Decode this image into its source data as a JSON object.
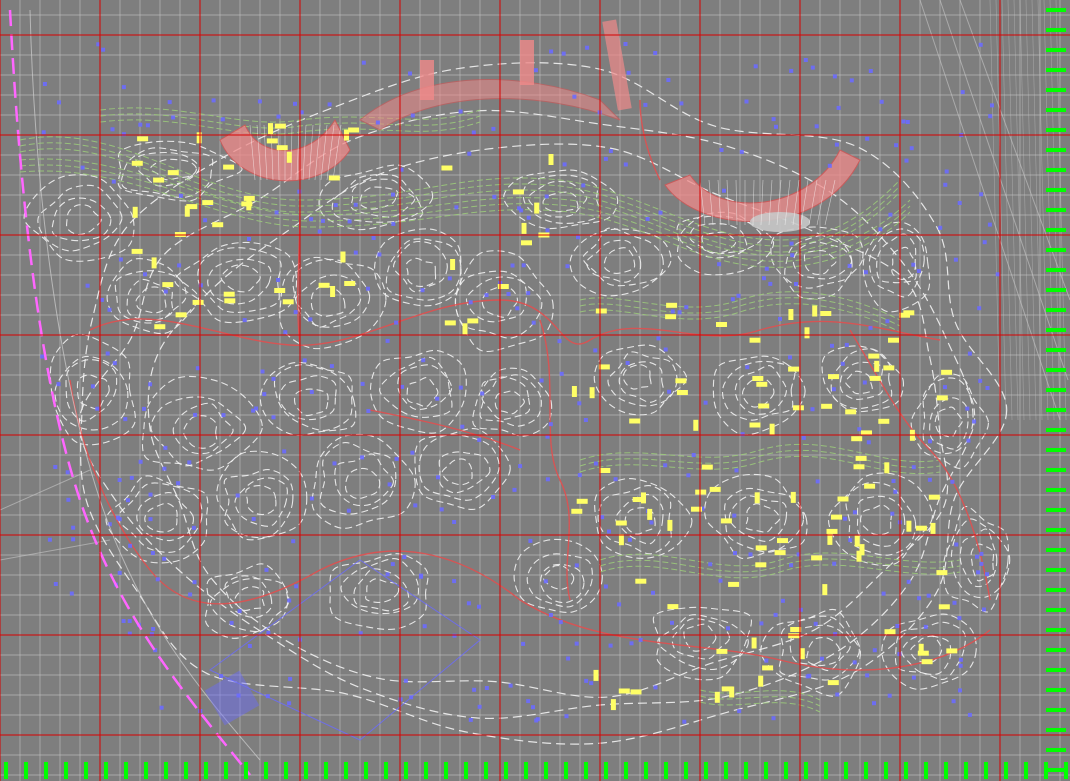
{
  "viewer": {
    "background_color": "#7e7e7e",
    "minor_grid_color": "#c8c8c8",
    "major_grid_color": "#d80000",
    "contour_color": "#f2f2f2",
    "green_contour_color": "#9ccc7a",
    "red_path_color": "#e05050",
    "plaza_color": "#f08a8a",
    "tree_color": "#ffff66",
    "point_color": "#6b6bff",
    "boundary_color": "#ff66ff",
    "ruler_color": "#00ff00",
    "rail_color": "#bdbdbd"
  },
  "layers": {
    "grid": "grid-layer",
    "contours": "contour-layer",
    "paths": "path-layer",
    "plazas": "plaza-layer",
    "trees": "tree-marker-layer",
    "points": "survey-point-layer",
    "boundary": "site-boundary-layer",
    "rulers": "ruler-layer"
  }
}
